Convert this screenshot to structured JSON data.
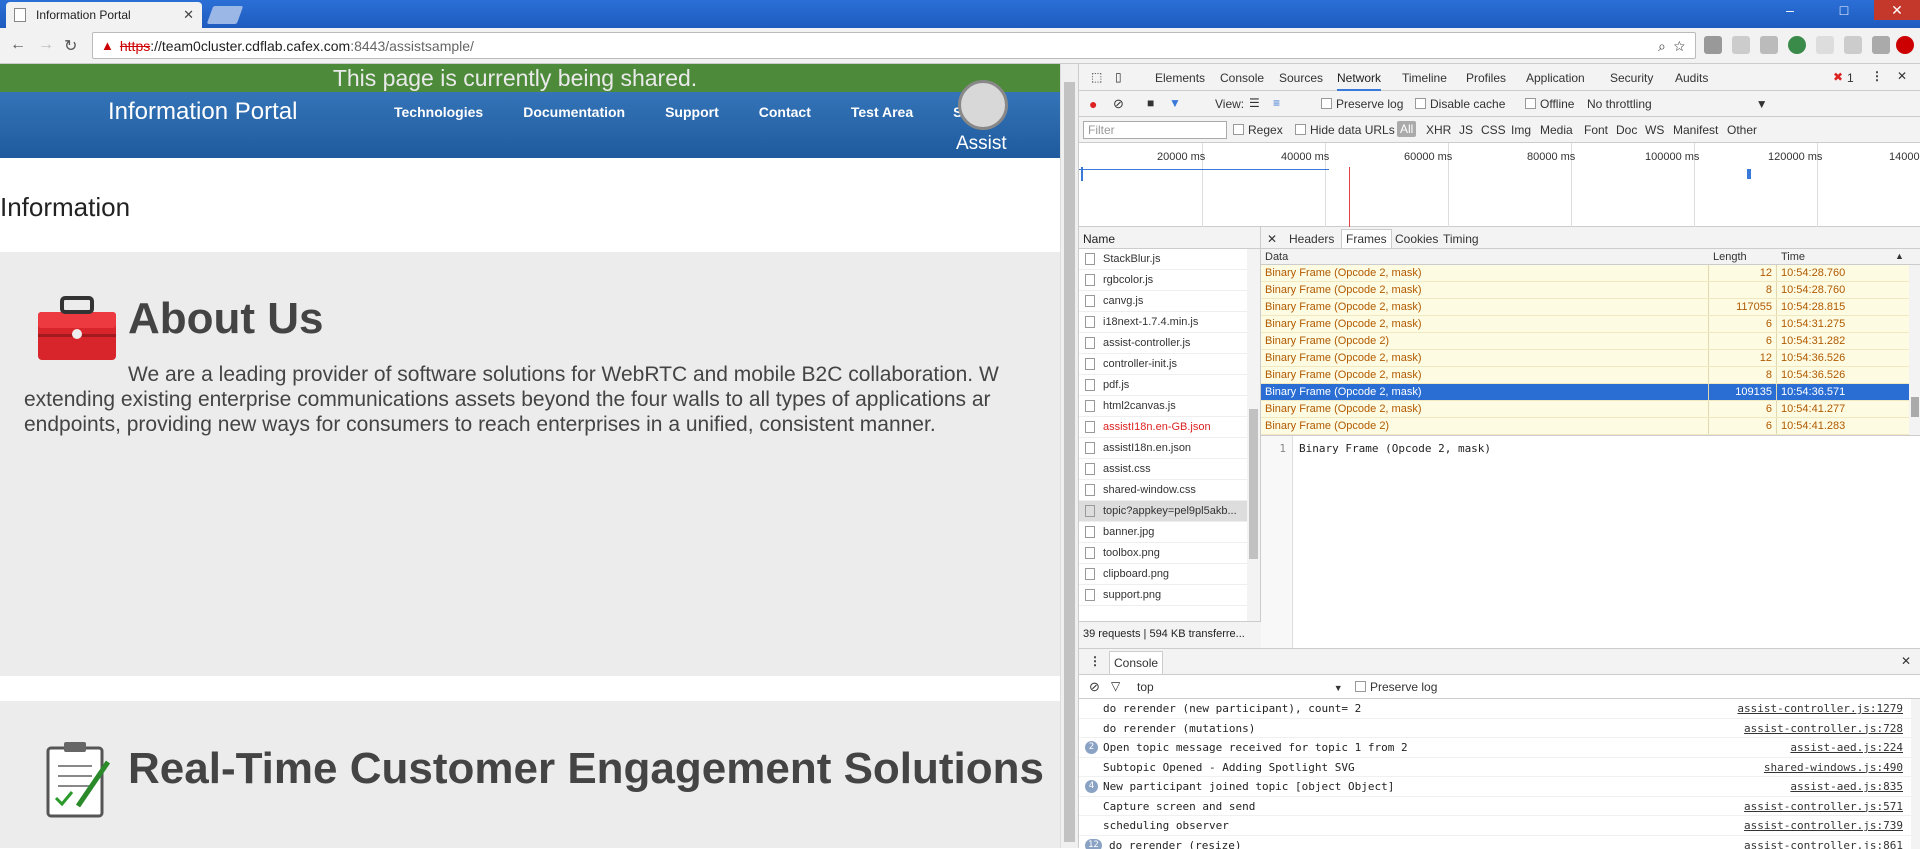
{
  "browser": {
    "tab_title": "Information Portal",
    "url_scheme": "https",
    "url_host": "://team0cluster.cdflab.cafex.com",
    "url_path": ":8443/assistsample/"
  },
  "page": {
    "shared_banner": "This page is currently being shared.",
    "portal_title": "Information Portal",
    "nav": [
      "Technologies",
      "Documentation",
      "Support",
      "Contact",
      "Test Area",
      "Su..."
    ],
    "assist_label": "Assist",
    "info_heading": "Information",
    "about_title": "About Us",
    "about_text_1": "We are a leading provider of software solutions for WebRTC and mobile B2C collaboration. W",
    "about_text_2": "extending existing enterprise communications assets beyond the four walls to all types of applications ar",
    "about_text_3": "endpoints, providing new ways for consumers to reach enterprises in a unified, consistent manner.",
    "rtce_title": "Real-Time Customer Engagement Solutions"
  },
  "devtools": {
    "tabs": [
      "Elements",
      "Console",
      "Sources",
      "Network",
      "Timeline",
      "Profiles",
      "Application",
      "Security",
      "Audits"
    ],
    "active_tab": "Network",
    "error_count": "1",
    "toolbar": {
      "view_label": "View:",
      "preserve_log": "Preserve log",
      "disable_cache": "Disable cache",
      "offline": "Offline",
      "throttling": "No throttling"
    },
    "filter": {
      "placeholder": "Filter",
      "regex": "Regex",
      "hide_data_urls": "Hide data URLs",
      "types": [
        "All",
        "XHR",
        "JS",
        "CSS",
        "Img",
        "Media",
        "Font",
        "Doc",
        "WS",
        "Manifest",
        "Other"
      ]
    },
    "timeline_labels": [
      "20000 ms",
      "40000 ms",
      "60000 ms",
      "80000 ms",
      "100000 ms",
      "120000 ms",
      "14000"
    ],
    "name_header": "Name",
    "requests": [
      {
        "name": "StackBlur.js",
        "style": ""
      },
      {
        "name": "rgbcolor.js",
        "style": ""
      },
      {
        "name": "canvg.js",
        "style": ""
      },
      {
        "name": "i18next-1.7.4.min.js",
        "style": ""
      },
      {
        "name": "assist-controller.js",
        "style": ""
      },
      {
        "name": "controller-init.js",
        "style": ""
      },
      {
        "name": "pdf.js",
        "style": ""
      },
      {
        "name": "html2canvas.js",
        "style": ""
      },
      {
        "name": "assistI18n.en-GB.json",
        "style": "red"
      },
      {
        "name": "assistI18n.en.json",
        "style": ""
      },
      {
        "name": "assist.css",
        "style": ""
      },
      {
        "name": "shared-window.css",
        "style": ""
      },
      {
        "name": "topic?appkey=pel9pl5akb...",
        "style": "sel"
      },
      {
        "name": "banner.jpg",
        "style": ""
      },
      {
        "name": "toolbox.png",
        "style": ""
      },
      {
        "name": "clipboard.png",
        "style": ""
      },
      {
        "name": "support.png",
        "style": ""
      }
    ],
    "status": "39 requests | 594 KB transferre...",
    "detail_tabs": [
      "Headers",
      "Frames",
      "Cookies",
      "Timing"
    ],
    "frames_columns": [
      "Data",
      "Length",
      "Time"
    ],
    "frames": [
      {
        "data": "Binary Frame (Opcode 2, mask)",
        "length": "12",
        "time": "10:54:28.760"
      },
      {
        "data": "Binary Frame (Opcode 2, mask)",
        "length": "8",
        "time": "10:54:28.760"
      },
      {
        "data": "Binary Frame (Opcode 2, mask)",
        "length": "117055",
        "time": "10:54:28.815"
      },
      {
        "data": "Binary Frame (Opcode 2, mask)",
        "length": "6",
        "time": "10:54:31.275"
      },
      {
        "data": "Binary Frame (Opcode 2)",
        "length": "6",
        "time": "10:54:31.282"
      },
      {
        "data": "Binary Frame (Opcode 2, mask)",
        "length": "12",
        "time": "10:54:36.526"
      },
      {
        "data": "Binary Frame (Opcode 2, mask)",
        "length": "8",
        "time": "10:54:36.526"
      },
      {
        "data": "Binary Frame (Opcode 2, mask)",
        "length": "109135",
        "time": "10:54:36.571",
        "selected": true
      },
      {
        "data": "Binary Frame (Opcode 2, mask)",
        "length": "6",
        "time": "10:54:41.277"
      },
      {
        "data": "Binary Frame (Opcode 2)",
        "length": "6",
        "time": "10:54:41.283"
      }
    ],
    "preview_line_no": "1",
    "preview_text": "Binary Frame (Opcode 2, mask)",
    "console": {
      "title": "Console",
      "context": "top",
      "preserve_log": "Preserve log",
      "messages": [
        {
          "count": "",
          "text": "do rerender (new participant), count= 2",
          "src": "assist-controller.js:1279"
        },
        {
          "count": "",
          "text": "do rerender (mutations)",
          "src": "assist-controller.js:728"
        },
        {
          "count": "2",
          "text": "Open topic message received for topic 1 from 2",
          "src": "assist-aed.js:224"
        },
        {
          "count": "",
          "text": "Subtopic Opened - Adding Spotlight SVG",
          "src": "shared-windows.js:490"
        },
        {
          "count": "4",
          "text": "New participant joined topic [object Object]",
          "src": "assist-aed.js:835"
        },
        {
          "count": "",
          "text": "Capture screen and send",
          "src": "assist-controller.js:571"
        },
        {
          "count": "",
          "text": "scheduling observer",
          "src": "assist-controller.js:739"
        },
        {
          "count": "12",
          "text": "do rerender (resize)",
          "src": "assist-controller.js:861"
        }
      ]
    }
  }
}
